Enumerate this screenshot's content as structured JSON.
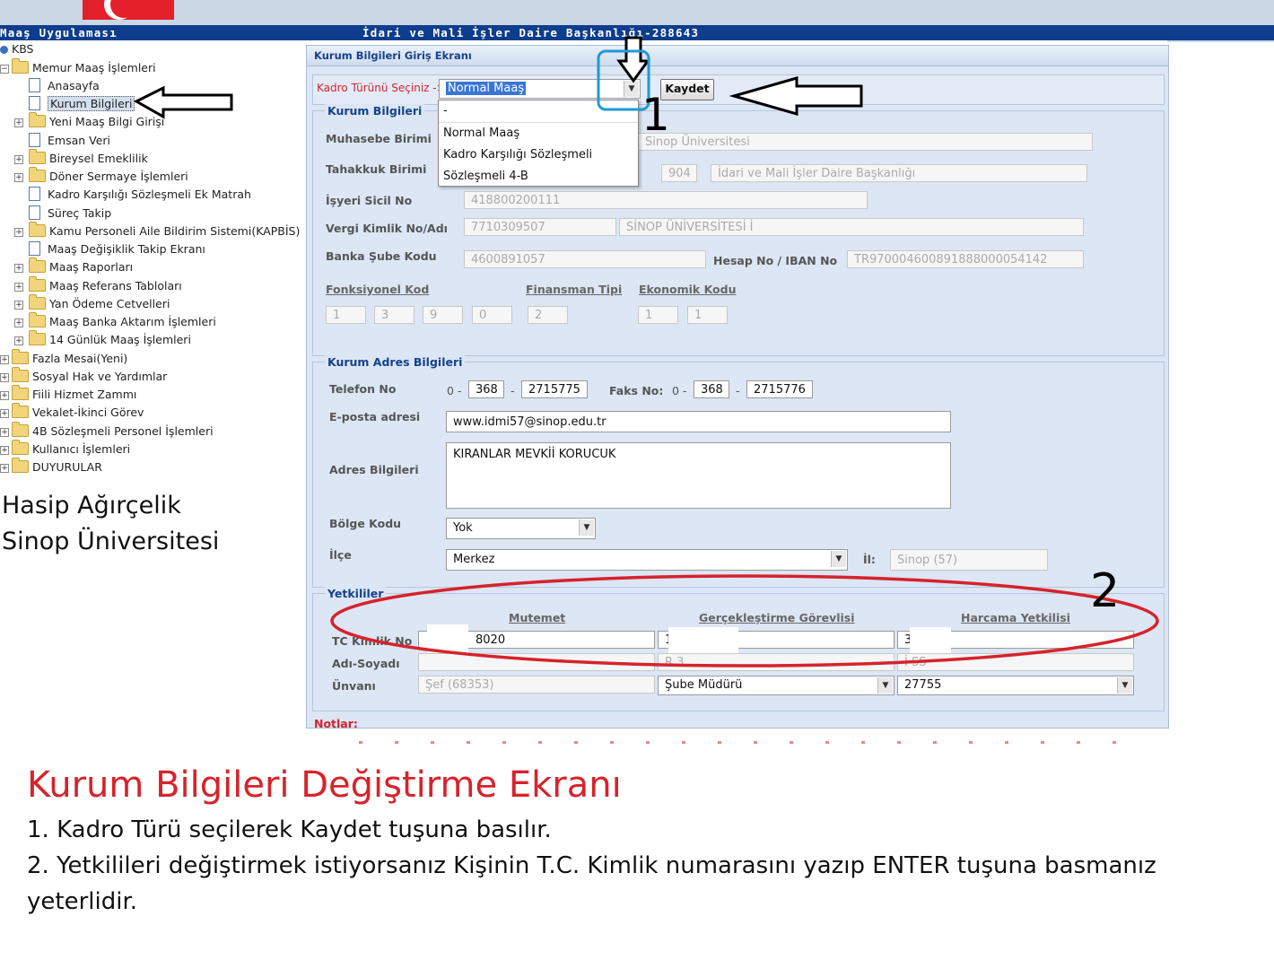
{
  "header": {
    "app_title": "Maaş Uygulaması",
    "org_title": "İdari ve Mali İşler Daire Başkanlığı-288643"
  },
  "tree": {
    "root": "KBS",
    "items": [
      "Memur Maaş İşlemleri",
      "Anasayfa",
      "Kurum Bilgileri",
      "Yeni Maaş Bilgi Girişi",
      "Emsan Veri",
      "Bireysel Emeklilik",
      "Döner Sermaye İşlemleri",
      "Kadro Karşılığı Sözleşmeli Ek Matrah",
      "Süreç Takip",
      "Kamu Personeli Aile Bildirim Sistemi(KAPBİS)",
      "Maaş Değişiklik Takip Ekranı",
      "Maaş Raporları",
      "Maaş Referans Tabloları",
      "Yan Ödeme Cetvelleri",
      "Maaş Banka Aktarım İşlemleri",
      "14 Günlük Maaş İşlemleri",
      "Fazla Mesai(Yeni)",
      "Sosyal Hak ve Yardımlar",
      "Fiili Hizmet Zammı",
      "Vekalet-İkinci Görev",
      "4B Sözleşmeli Personel İşlemleri",
      "Kullanıcı İşlemleri",
      "DUYURULAR"
    ]
  },
  "signature": {
    "name": "Hasip Ağırçelik",
    "org": "Sinop Üniversitesi"
  },
  "form": {
    "title": "Kurum Bilgileri Giriş Ekranı",
    "kadro_label": "Kadro Türünü Seçiniz ->",
    "kadro_value": "Normal Maaş",
    "kadro_options": [
      "-",
      "Normal Maaş",
      "Kadro Karşılığı Sözleşmeli",
      "Sözleşmeli 4-B"
    ],
    "save_label": "Kaydet",
    "kurum": {
      "legend": "Kurum Bilgileri",
      "muhasebe_label": "Muhasebe Birimi",
      "muhasebe_value": "Sinop Üniversitesi",
      "tahakkuk_label": "Tahakkuk Birimi",
      "tahakkuk_code": "904",
      "tahakkuk_value": "İdari ve Mali İşler Daire Başkanlığı",
      "isyeri_label": "İşyeri Sicil No",
      "isyeri_value": "418800200111",
      "vergi_label": "Vergi Kimlik No/Adı",
      "vergi_no": "7710309507",
      "vergi_adi": "SİNOP ÜNİVERSİTESİ İ",
      "banka_label": "Banka Şube Kodu",
      "banka_value": "4600891057",
      "iban_label": "Hesap No / IBAN No",
      "iban_value": "TR970004600891888000054142",
      "fonk_label": "Fonksiyonel Kod",
      "fonk_values": [
        "1",
        "3",
        "9",
        "0"
      ],
      "fin_label": "Finansman Tipi",
      "fin_value": "2",
      "eko_label": "Ekonomik Kodu",
      "eko_values": [
        "1",
        "1"
      ]
    },
    "adres": {
      "legend": "Kurum Adres Bilgileri",
      "tel_label": "Telefon No",
      "tel_prefix": "0 -",
      "tel_area": "368",
      "tel_number": "2715775",
      "faks_label": "Faks No:",
      "faks_prefix": "0 -",
      "faks_area": "368",
      "faks_number": "2715776",
      "dash": "-",
      "email_label": "E-posta adresi",
      "email_value": "www.idmi57@sinop.edu.tr",
      "adres_label": "Adres Bilgileri",
      "adres_value": "KIRANLAR MEVKİİ KORUCUK",
      "bolge_label": "Bölge Kodu",
      "bolge_value": "Yok",
      "ilce_label": "İlçe",
      "ilce_value": "Merkez",
      "il_label": "İl:",
      "il_value": "Sinop (57)"
    },
    "yetkililer": {
      "legend": "Yetkililer",
      "columns": [
        "Mutemet",
        "Gerçekleştirme Görevlisi",
        "Harcama Yetkilisi"
      ],
      "tc_label": "TC Kimlik No",
      "ad_label": "Adı-Soyadı",
      "unvan_label": "Ünvanı",
      "tc_values": [
        "8020",
        "1",
        "3         0820"
      ],
      "ad_values": [
        "",
        "R                           3",
        "İ                           SS"
      ],
      "unvan_values": [
        "Şef (68353)",
        "Şube Müdürü",
        "27755"
      ]
    },
    "notlar_label": "Notlar:"
  },
  "annotations": {
    "marker_1": "1",
    "marker_2": "2",
    "title": "Kurum Bilgileri Değiştirme Ekranı",
    "step1": "1. Kadro Türü seçilerek Kaydet tuşuna basılır.",
    "step2_line1": "2. Yetkilileri değiştirmek istiyorsanız Kişinin T.C. Kimlik numarasını yazıp ENTER tuşuna basmanız",
    "step2_line2": "yeterlidir."
  },
  "colors": {
    "header_bar": "#0d3d8c",
    "panel_bg": "#dce6f4",
    "annotation_red": "#d6232c",
    "highlight_blue": "#1e9ad6"
  }
}
